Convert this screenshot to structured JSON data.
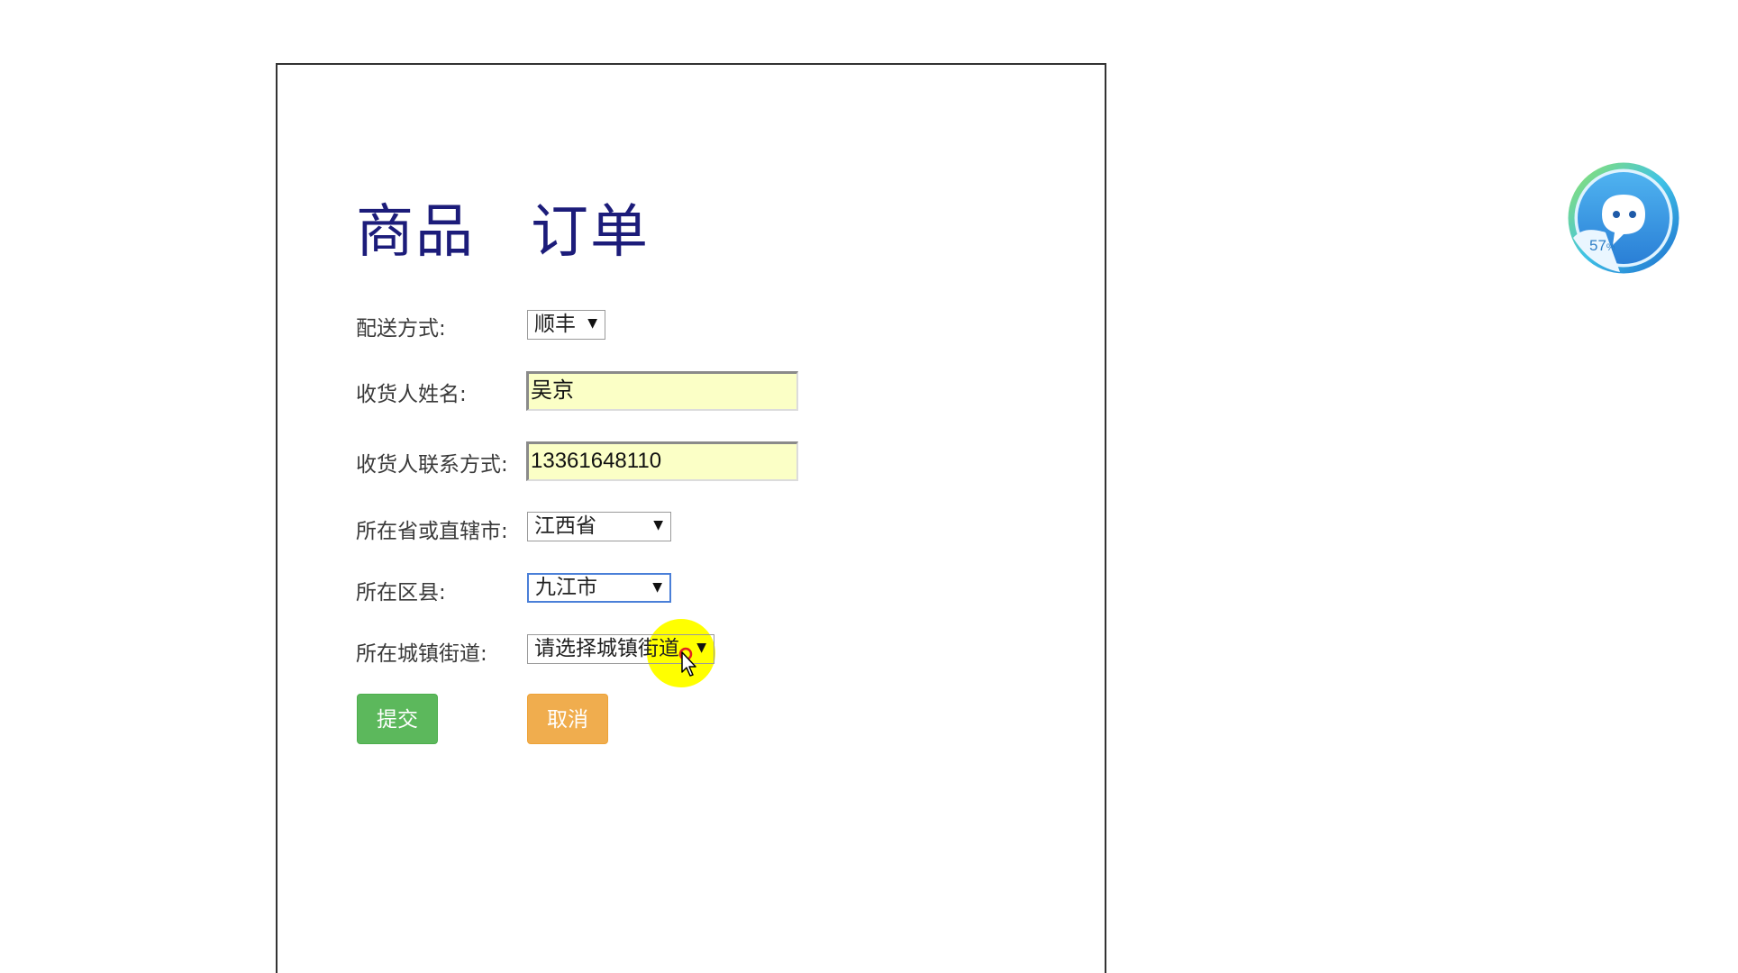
{
  "title": {
    "left": "商品",
    "right": "订单"
  },
  "form": {
    "delivery": {
      "label": "配送方式:",
      "value": "顺丰"
    },
    "recipient_name": {
      "label": "收货人姓名:",
      "value": "吴京"
    },
    "recipient_phone": {
      "label": "收货人联系方式:",
      "value": "13361648110"
    },
    "province": {
      "label": "所在省或直辖市:",
      "value": "江西省"
    },
    "district": {
      "label": "所在区县:",
      "value": "九江市"
    },
    "street": {
      "label": "所在城镇街道:",
      "value": "请选择城镇街道"
    },
    "submit_label": "提交",
    "cancel_label": "取消"
  },
  "widget": {
    "percent": "57",
    "percent_sign": "%"
  },
  "colors": {
    "title": "#1c1c7a",
    "submit": "#5cb85c",
    "cancel": "#f0ad4e",
    "input_bg": "#fbffc6",
    "focus": "#4a7fd8",
    "cursor_highlight": "#ffff00"
  },
  "icons": {
    "dropdown": "triangle-down-icon",
    "cursor": "mouse-pointer-icon",
    "widget": "chat-bubble-icon"
  }
}
